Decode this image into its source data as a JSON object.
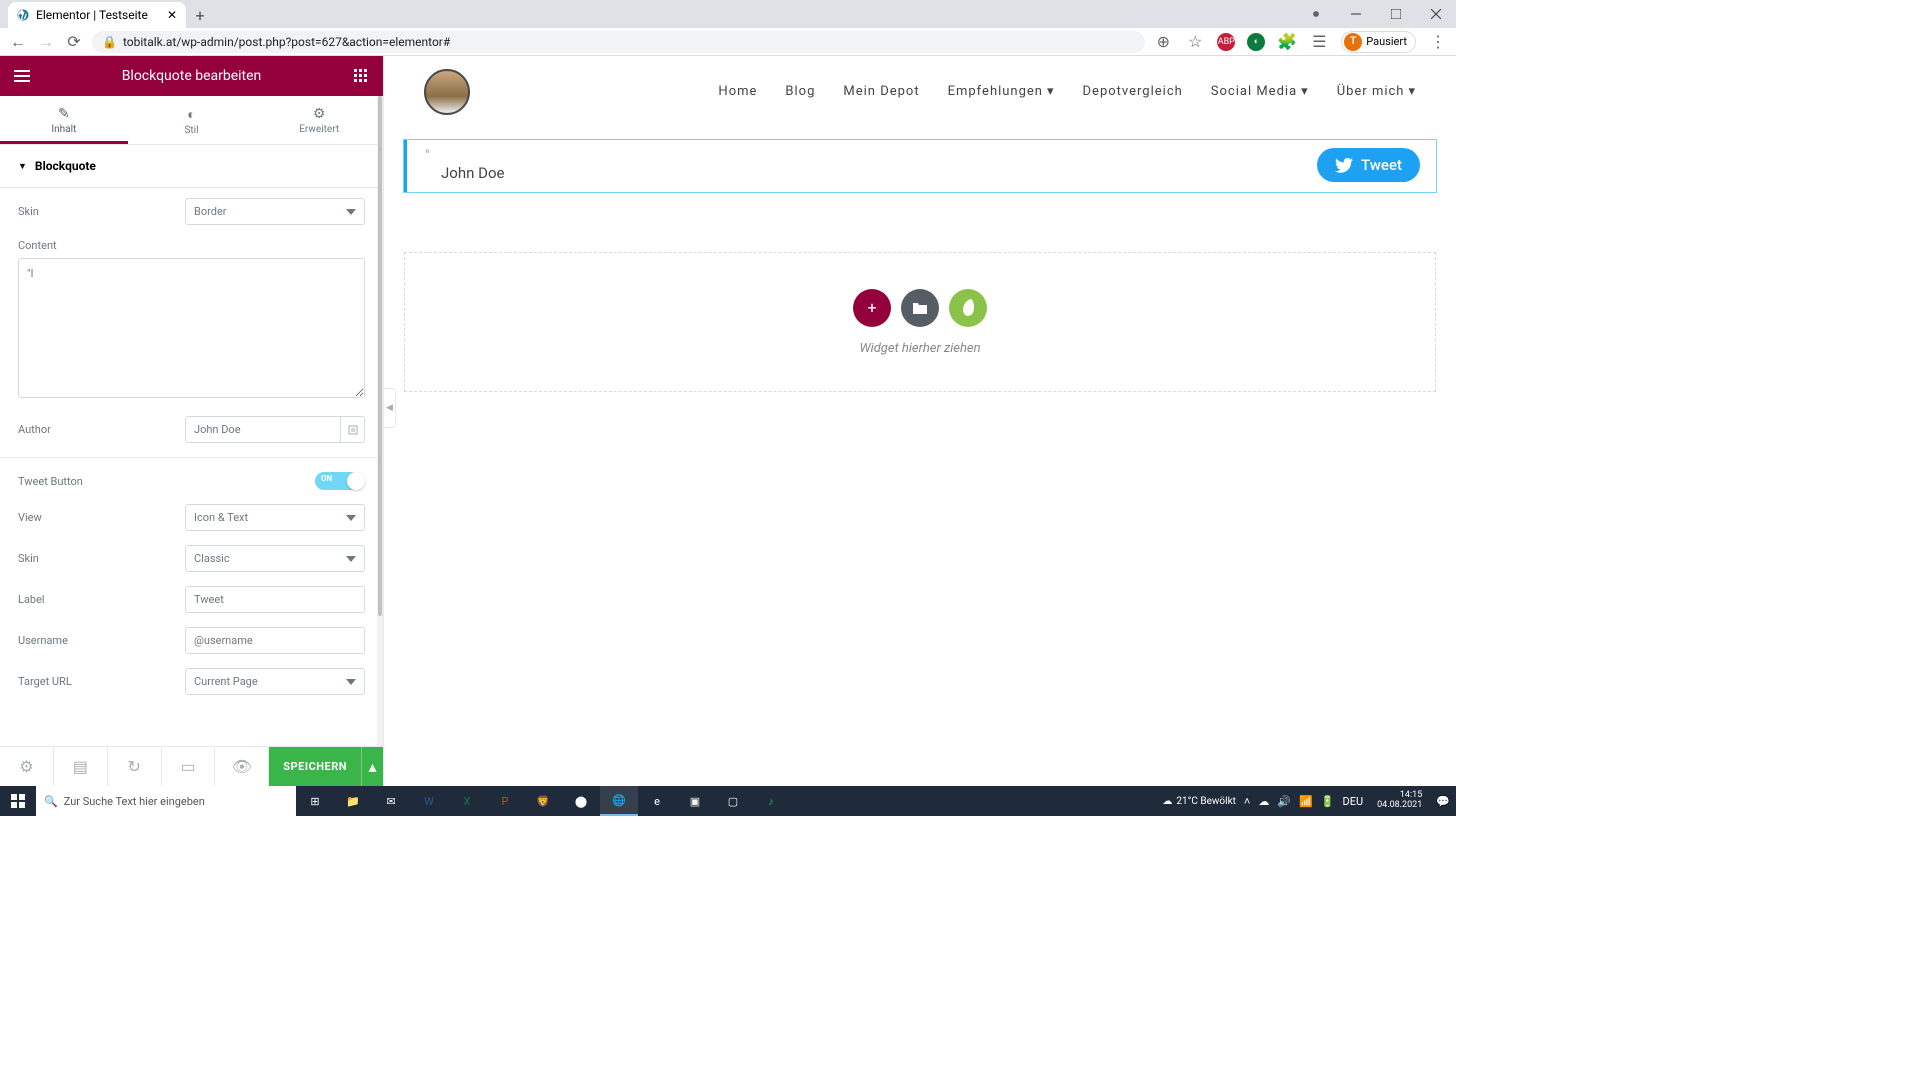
{
  "browser": {
    "tab_title": "Elementor | Testseite",
    "url": "tobitalk.at/wp-admin/post.php?post=627&action=elementor#",
    "profile_label": "Pausiert",
    "profile_initial": "T"
  },
  "elementor": {
    "header_title": "Blockquote bearbeiten",
    "tabs": {
      "content": "Inhalt",
      "style": "Stil",
      "advanced": "Erweitert"
    },
    "section_title": "Blockquote",
    "fields": {
      "skin_label": "Skin",
      "skin_value": "Border",
      "content_label": "Content",
      "content_value": "\"I",
      "author_label": "Author",
      "author_value": "John Doe",
      "tweet_button_label": "Tweet Button",
      "tweet_toggle": "ON",
      "view_label": "View",
      "view_value": "Icon & Text",
      "skin2_label": "Skin",
      "skin2_value": "Classic",
      "label_label": "Label",
      "label_value": "Tweet",
      "username_label": "Username",
      "username_placeholder": "@username",
      "target_label": "Target URL",
      "target_value": "Current Page"
    },
    "footer": {
      "save": "SPEICHERN"
    }
  },
  "site": {
    "nav": [
      "Home",
      "Blog",
      "Mein Depot",
      "Empfehlungen",
      "Depotvergleich",
      "Social Media",
      "Über mich"
    ]
  },
  "preview": {
    "quote_mark": "\"",
    "author": "John Doe",
    "tweet_label": "Tweet",
    "drop_hint": "Widget hierher ziehen"
  },
  "taskbar": {
    "search_placeholder": "Zur Suche Text hier eingeben",
    "weather": "21°C  Bewölkt",
    "lang": "DEU",
    "time": "14:15",
    "date": "04.08.2021"
  }
}
